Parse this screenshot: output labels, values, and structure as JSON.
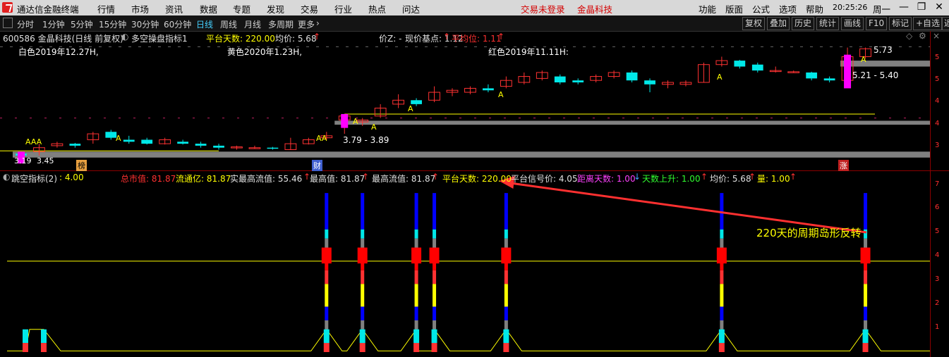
{
  "menubar": {
    "app_title": "通达信金融终端",
    "items": [
      "行情",
      "市场",
      "资讯",
      "数据",
      "专题",
      "发现",
      "交易",
      "行业",
      "热点",
      "问达"
    ],
    "status_login": "交易未登录",
    "status_stock": "金晶科技",
    "right_items": [
      "功能",
      "版面",
      "公式",
      "选项",
      "帮助"
    ],
    "clock": "20:25:26",
    "weekday": "周一"
  },
  "toolbar": {
    "periods": [
      "分时",
      "1分钟",
      "5分钟",
      "15分钟",
      "30分钟",
      "60分钟",
      "日线",
      "周线",
      "月线",
      "多周期",
      "更多"
    ],
    "active_period": "日线",
    "right_buttons": [
      "复权",
      "叠加",
      "历史",
      "统计",
      "画线",
      "F10",
      "标记",
      "+自选",
      "返"
    ]
  },
  "main_header": {
    "stock": "600586 金晶科技(日线 前复权)",
    "indicator": "多空操盘指标1",
    "platform_days": "平台天数: 220.00",
    "avg_price": "均价: 5.68",
    "price_z": "价Z: -",
    "current_base": "现价基点: 1.12",
    "platform_avg": "平均位: 1.11"
  },
  "annotations": {
    "white_label": "白色2019年12.27H,",
    "yellow_label": "黄色2020年1.23H,",
    "red_label": "红色2019年11.11H:",
    "range_low": "3.79 - 3.89",
    "range_high": "5.21 - 5.40",
    "price_high": "5.73",
    "price_low": "3.19",
    "price_low2": "3.45",
    "marker_aaa": "AAA",
    "marker_aa": "AA",
    "marker_a": "A",
    "tag_bang": "榜",
    "tag_cai": "财",
    "tag_zhang": "涨"
  },
  "main_axis": [
    "5",
    "5",
    "4",
    "4",
    "3"
  ],
  "sub_header": {
    "indicator": "跳空指标(2)",
    "indicator_value": ": 4.00",
    "total_mv": "总市值: 81.87",
    "float_cap": "流通亿: 81.87",
    "real_float_high": "实最高流值: 55.46",
    "max_value": "最高值: 81.87",
    "max_float": "最高流值: 81.87",
    "platform_days": "平台天数: 220.00",
    "platform_signal": "平台信号价: 4.05",
    "distance_days": "距离天数: 1.00",
    "days_up": "天数上升: 1.00",
    "avg_price": "均价: 5.68",
    "volume": "量: 1.00"
  },
  "sub_axis": [
    "7",
    "6",
    "5",
    "4",
    "3",
    "2",
    "1"
  ],
  "callout": "220天的周期岛形反转",
  "colors": {
    "up": "#ff3232",
    "down": "#00e8e8",
    "magenta": "#ff00ff",
    "yellow": "#ffff00",
    "gray_band": "#808080",
    "blue": "#0000ff",
    "arrow": "#ff3030"
  },
  "chart_data": {
    "type": "candlestick",
    "price_candles": [
      {
        "o": 3.05,
        "c": 3.0,
        "h": 3.1,
        "l": 2.95
      },
      {
        "o": 3.1,
        "c": 3.2,
        "h": 3.3,
        "l": 3.0
      },
      {
        "o": 3.25,
        "c": 3.3,
        "h": 3.35,
        "l": 3.2
      },
      {
        "o": 3.3,
        "c": 3.25,
        "h": 3.32,
        "l": 3.2
      },
      {
        "o": 3.4,
        "c": 3.55,
        "h": 3.6,
        "l": 3.3
      },
      {
        "o": 3.6,
        "c": 3.45,
        "h": 3.65,
        "l": 3.4
      },
      {
        "o": 3.4,
        "c": 3.35,
        "h": 3.5,
        "l": 3.3
      },
      {
        "o": 3.4,
        "c": 3.3,
        "h": 3.45,
        "l": 3.28
      },
      {
        "o": 3.3,
        "c": 3.4,
        "h": 3.45,
        "l": 3.28
      },
      {
        "o": 3.35,
        "c": 3.3,
        "h": 3.4,
        "l": 3.28
      },
      {
        "o": 3.3,
        "c": 3.25,
        "h": 3.35,
        "l": 3.2
      },
      {
        "o": 3.25,
        "c": 3.2,
        "h": 3.3,
        "l": 3.15
      },
      {
        "o": 3.2,
        "c": 3.22,
        "h": 3.25,
        "l": 3.15
      },
      {
        "o": 3.2,
        "c": 3.2,
        "h": 3.25,
        "l": 3.18
      },
      {
        "o": 3.2,
        "c": 3.18,
        "h": 3.22,
        "l": 3.15
      },
      {
        "o": 3.15,
        "c": 3.3,
        "h": 3.45,
        "l": 3.15
      },
      {
        "o": 3.3,
        "c": 3.4,
        "h": 3.45,
        "l": 3.28
      },
      {
        "o": 3.45,
        "c": 3.5,
        "h": 3.6,
        "l": 3.4
      },
      {
        "o": 3.9,
        "c": 4.0,
        "h": 4.05,
        "l": 3.55
      },
      {
        "o": 3.85,
        "c": 3.9,
        "h": 3.95,
        "l": 3.75
      },
      {
        "o": 4.0,
        "c": 4.2,
        "h": 4.3,
        "l": 3.95
      },
      {
        "o": 4.3,
        "c": 4.4,
        "h": 4.55,
        "l": 4.2
      },
      {
        "o": 4.4,
        "c": 4.3,
        "h": 4.45,
        "l": 4.25
      },
      {
        "o": 4.4,
        "c": 4.6,
        "h": 4.75,
        "l": 4.35
      },
      {
        "o": 4.6,
        "c": 4.65,
        "h": 4.7,
        "l": 4.5
      },
      {
        "o": 4.6,
        "c": 4.7,
        "h": 4.75,
        "l": 4.55
      },
      {
        "o": 4.7,
        "c": 4.65,
        "h": 4.8,
        "l": 4.6
      },
      {
        "o": 4.75,
        "c": 4.9,
        "h": 5.0,
        "l": 4.7
      },
      {
        "o": 4.85,
        "c": 5.0,
        "h": 5.1,
        "l": 4.8
      },
      {
        "o": 4.95,
        "c": 5.1,
        "h": 5.15,
        "l": 4.9
      },
      {
        "o": 5.0,
        "c": 4.85,
        "h": 5.05,
        "l": 4.8
      },
      {
        "o": 4.9,
        "c": 4.85,
        "h": 4.95,
        "l": 4.8
      },
      {
        "o": 4.9,
        "c": 5.0,
        "h": 5.05,
        "l": 4.85
      },
      {
        "o": 5.0,
        "c": 5.1,
        "h": 5.15,
        "l": 4.95
      },
      {
        "o": 5.1,
        "c": 4.9,
        "h": 5.15,
        "l": 4.85
      },
      {
        "o": 4.9,
        "c": 4.8,
        "h": 4.95,
        "l": 4.6
      },
      {
        "o": 4.8,
        "c": 4.85,
        "h": 4.9,
        "l": 4.7
      },
      {
        "o": 4.8,
        "c": 4.85,
        "h": 4.9,
        "l": 4.75
      },
      {
        "o": 4.85,
        "c": 5.3,
        "h": 5.35,
        "l": 4.85
      },
      {
        "o": 5.3,
        "c": 5.4,
        "h": 5.5,
        "l": 5.25
      },
      {
        "o": 5.4,
        "c": 5.25,
        "h": 5.42,
        "l": 5.2
      },
      {
        "o": 5.3,
        "c": 5.15,
        "h": 5.35,
        "l": 5.1
      },
      {
        "o": 5.15,
        "c": 5.15,
        "h": 5.25,
        "l": 5.1
      },
      {
        "o": 5.12,
        "c": 5.12,
        "h": 5.15,
        "l": 5.1
      },
      {
        "o": 5.1,
        "c": 4.95,
        "h": 5.12,
        "l": 4.9
      },
      {
        "o": 4.95,
        "c": 4.9,
        "h": 5.0,
        "l": 4.85
      },
      {
        "o": 4.9,
        "c": 5.5,
        "h": 5.73,
        "l": 4.9
      },
      {
        "o": 5.5,
        "c": 5.7,
        "h": 5.73,
        "l": 5.45
      }
    ],
    "platform_line": 4.05,
    "band_low": [
      3.79,
      3.89
    ],
    "band_high": [
      5.21,
      5.4
    ],
    "sub_signals_index": [
      17,
      19,
      22,
      23,
      27,
      39,
      47
    ],
    "sub_level_line": 4.0,
    "sub_ylim": [
      0,
      7.5
    ]
  }
}
